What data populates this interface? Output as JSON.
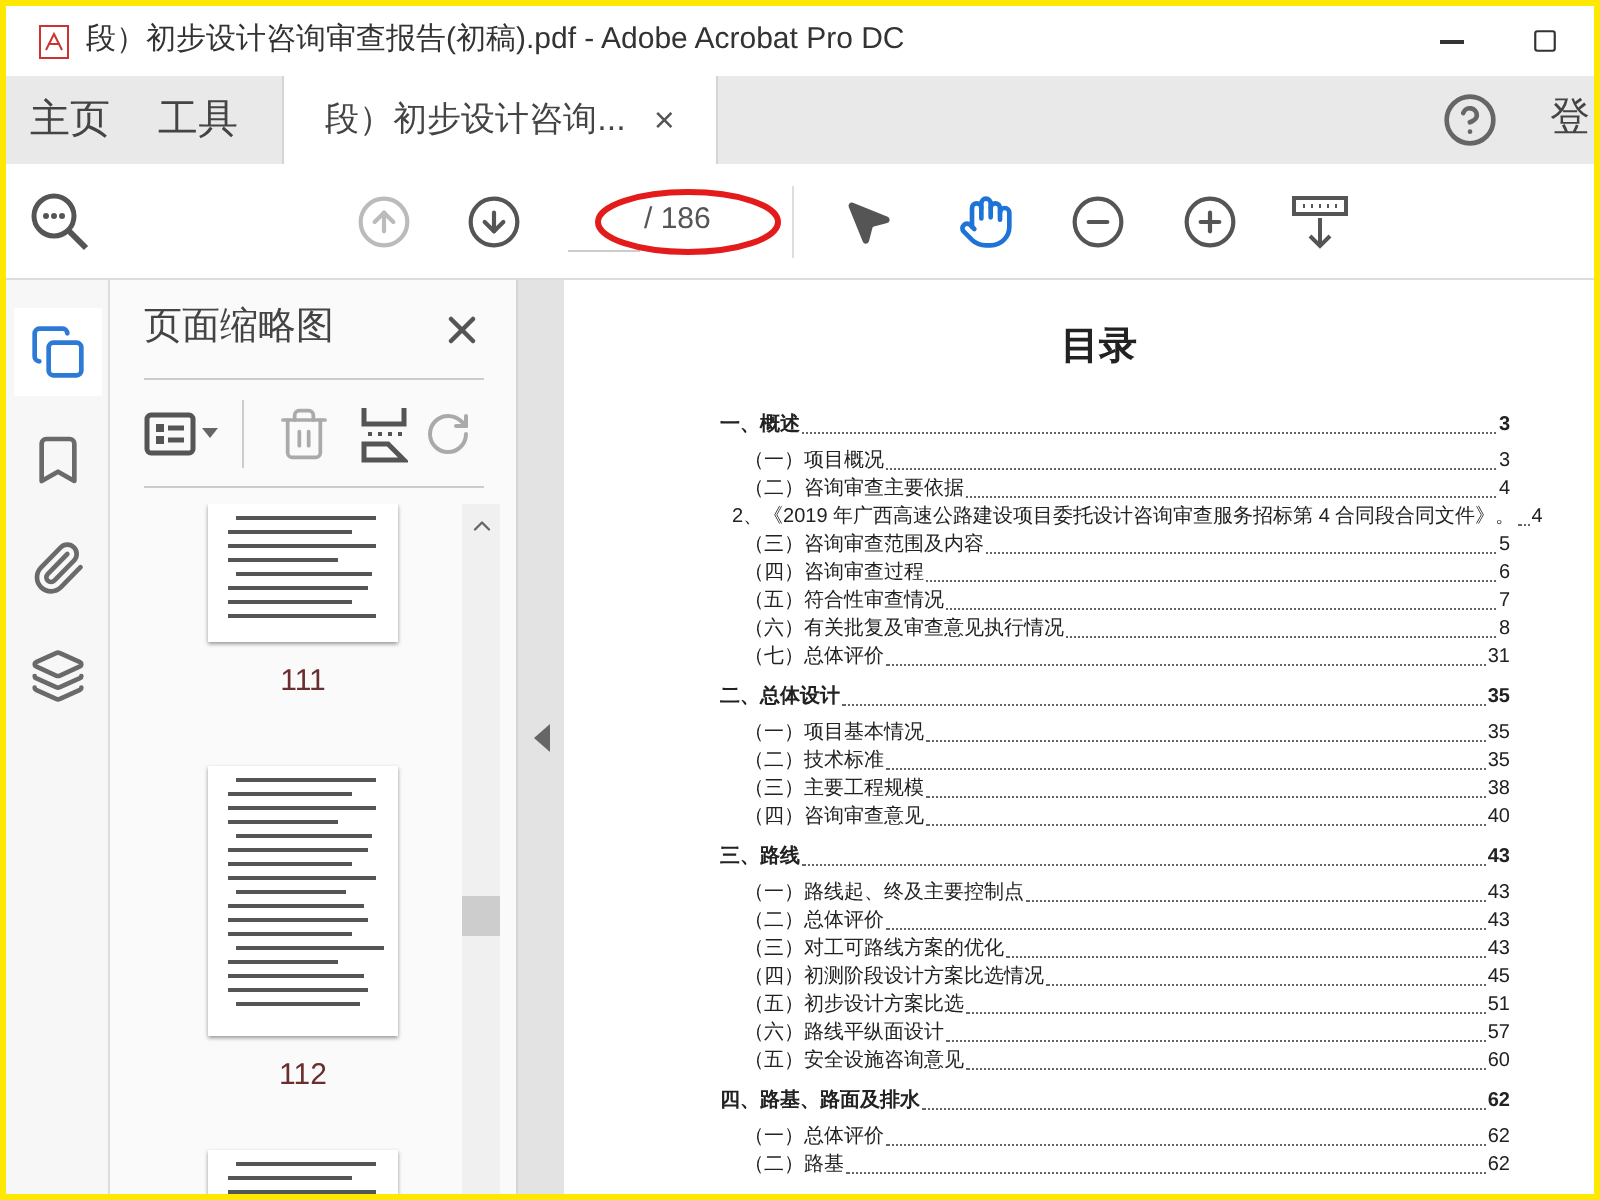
{
  "window": {
    "title": "段）初步设计咨询审查报告(初稿).pdf - Adobe Acrobat Pro DC"
  },
  "nav_tabs": [
    {
      "label": "主页",
      "selected": false
    },
    {
      "label": "工具",
      "selected": false
    },
    {
      "label": "段）初步设计咨询...",
      "selected": true,
      "close": "×"
    }
  ],
  "account": "登",
  "toolbar": {
    "prev_page": {
      "disabled": true
    },
    "next_page": {
      "disabled": false
    },
    "page_total": "/ 186",
    "tools": [
      {
        "kind": "select",
        "selected": false
      },
      {
        "kind": "hand",
        "selected": true
      }
    ]
  },
  "sidebar": {
    "items": [
      {
        "kind": "pages",
        "selected": true
      },
      {
        "kind": "bookmarks",
        "selected": false
      },
      {
        "kind": "attachments",
        "selected": false
      },
      {
        "kind": "layers",
        "selected": false
      }
    ]
  },
  "thumbnails_panel": {
    "title": "页面缩略图",
    "delete_disabled": true,
    "pages": [
      {
        "label": "111"
      },
      {
        "label": "112"
      }
    ]
  },
  "document": {
    "heading": "目录",
    "toc": [
      {
        "kind": "section",
        "text": "一、概述",
        "page": "3"
      },
      {
        "kind": "item",
        "text": "（一）项目概况",
        "page": "3"
      },
      {
        "kind": "item",
        "text": "（二）咨询审查主要依据",
        "page": "4"
      },
      {
        "kind": "note",
        "text": "2、《2019 年广西高速公路建设项目委托设计咨询审查服务招标第 4 合同段合同文件》。",
        "page": "4"
      },
      {
        "kind": "item",
        "text": "（三）咨询审查范围及内容",
        "page": "5"
      },
      {
        "kind": "item",
        "text": "（四）咨询审查过程",
        "page": "6"
      },
      {
        "kind": "item",
        "text": "（五）符合性审查情况",
        "page": "7"
      },
      {
        "kind": "item",
        "text": "（六）有关批复及审查意见执行情况",
        "page": "8"
      },
      {
        "kind": "item",
        "text": "（七）总体评价",
        "page": "31"
      },
      {
        "kind": "section",
        "text": "二、总体设计",
        "page": "35"
      },
      {
        "kind": "item",
        "text": "（一）项目基本情况",
        "page": "35"
      },
      {
        "kind": "item",
        "text": "（二）技术标准",
        "page": "35"
      },
      {
        "kind": "item",
        "text": "（三）主要工程规模",
        "page": "38"
      },
      {
        "kind": "item",
        "text": "（四）咨询审查意见",
        "page": "40"
      },
      {
        "kind": "section",
        "text": "三、路线",
        "page": "43"
      },
      {
        "kind": "item",
        "text": "（一）路线起、终及主要控制点",
        "page": "43"
      },
      {
        "kind": "item",
        "text": "（二）总体评价",
        "page": "43"
      },
      {
        "kind": "item",
        "text": "（三）对工可路线方案的优化",
        "page": "43"
      },
      {
        "kind": "item",
        "text": "（四）初测阶段设计方案比选情况",
        "page": "45"
      },
      {
        "kind": "item",
        "text": "（五）初步设计方案比选",
        "page": "51"
      },
      {
        "kind": "item",
        "text": "（六）路线平纵面设计",
        "page": "57"
      },
      {
        "kind": "item",
        "text": "（五）安全设施咨询意见",
        "page": "60"
      },
      {
        "kind": "section",
        "text": "四、路基、路面及排水",
        "page": "62"
      },
      {
        "kind": "item",
        "text": "（一）总体评价",
        "page": "62"
      },
      {
        "kind": "item",
        "text": "（二）路基",
        "page": "62"
      }
    ]
  }
}
